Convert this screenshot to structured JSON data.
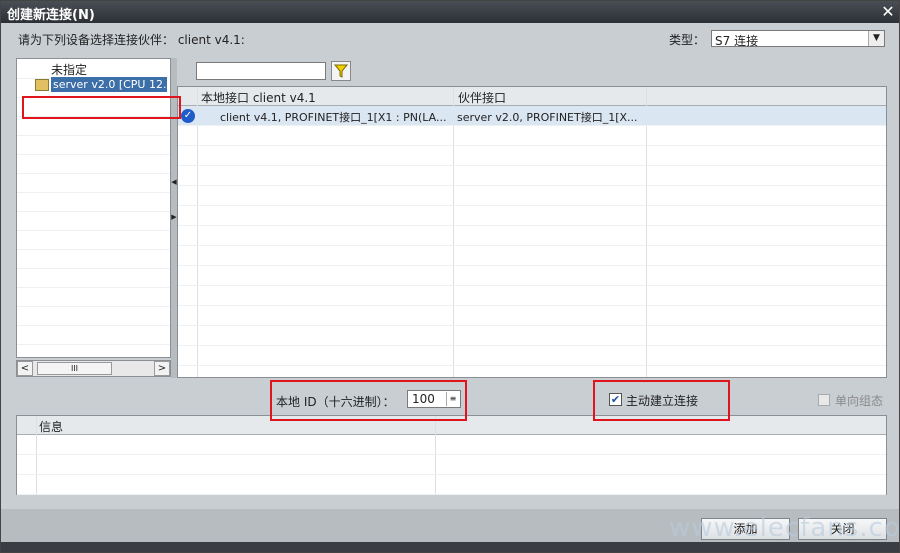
{
  "window": {
    "title": "创建新连接(N)",
    "close_glyph": "✕"
  },
  "prompt": "请为下列设备选择连接伙伴： client v4.1:",
  "type": {
    "label": "类型：",
    "value": "S7 连接"
  },
  "tree": {
    "items": [
      {
        "label": "未指定"
      },
      {
        "label": "server v2.0 [CPU 12..."
      }
    ],
    "scroll_left": "<",
    "scroll_right": ">",
    "thumb_grip": "III"
  },
  "grid": {
    "headers": [
      "本地接口 client v4.1",
      "伙伴接口"
    ],
    "rows": [
      {
        "local": "client v4.1, PROFINET接口_1[X1 : PN(LA...",
        "partner": "server v2.0, PROFINET接口_1[X..."
      }
    ]
  },
  "local_id": {
    "label": "本地 ID（十六进制）：",
    "value": "100"
  },
  "active_connect": {
    "label": "主动建立连接",
    "checked": true
  },
  "unidirectional": {
    "label": "单向组态",
    "checked": false
  },
  "info": {
    "header": "信息"
  },
  "buttons": {
    "add": "添加",
    "close": "关闭"
  },
  "watermark": "www.elecfans.com",
  "colors": {
    "titlebar": "#2c3035",
    "selection": "#3c6ea8",
    "highlight": "#e0151c",
    "check": "#1f5cc8"
  }
}
